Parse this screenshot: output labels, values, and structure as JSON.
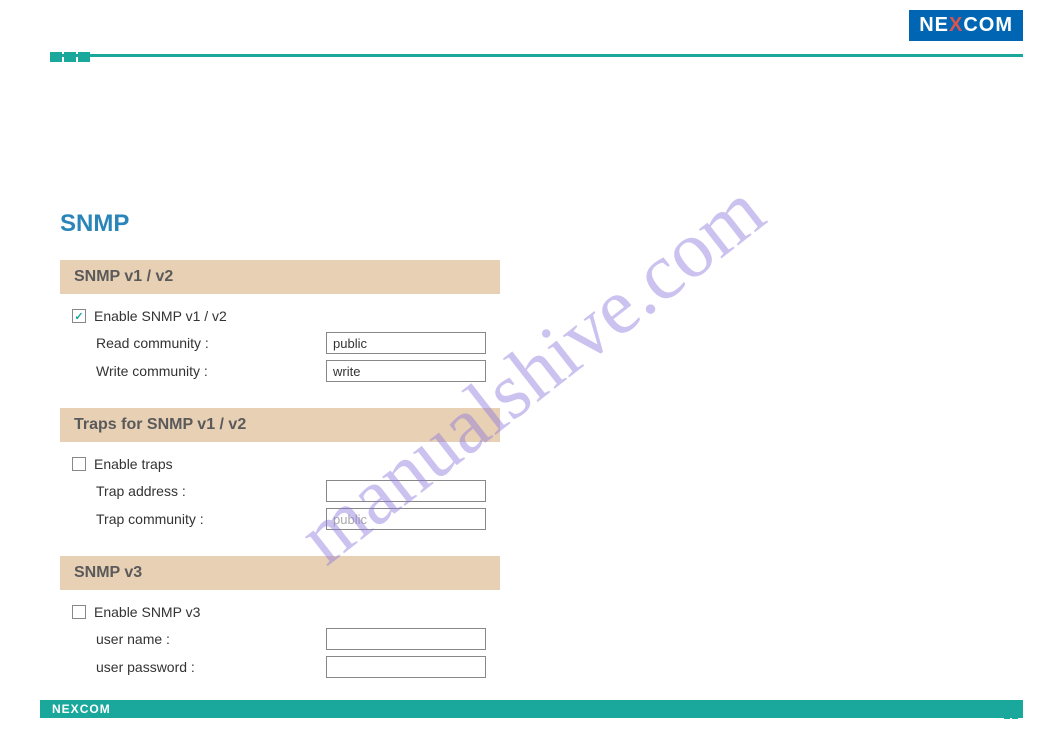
{
  "brand": {
    "name_pre": "NE",
    "name_x": "X",
    "name_post": "COM"
  },
  "watermark": "manualshive.com",
  "page": {
    "title": "SNMP",
    "sections": {
      "v1v2": {
        "header": "SNMP v1 / v2",
        "enable_label": "Enable SNMP v1 / v2",
        "enable_checked": true,
        "read_label": "Read community :",
        "read_value": "public",
        "write_label": "Write community :",
        "write_value": "write"
      },
      "traps": {
        "header": "Traps for SNMP v1 / v2",
        "enable_label": "Enable traps",
        "enable_checked": false,
        "addr_label": "Trap address :",
        "addr_value": "",
        "comm_label": "Trap community :",
        "comm_value": "public"
      },
      "v3": {
        "header": "SNMP v3",
        "enable_label": "Enable SNMP v3",
        "enable_checked": false,
        "user_label": "user name :",
        "user_value": "",
        "pass_label": "user password :",
        "pass_value": ""
      }
    }
  }
}
